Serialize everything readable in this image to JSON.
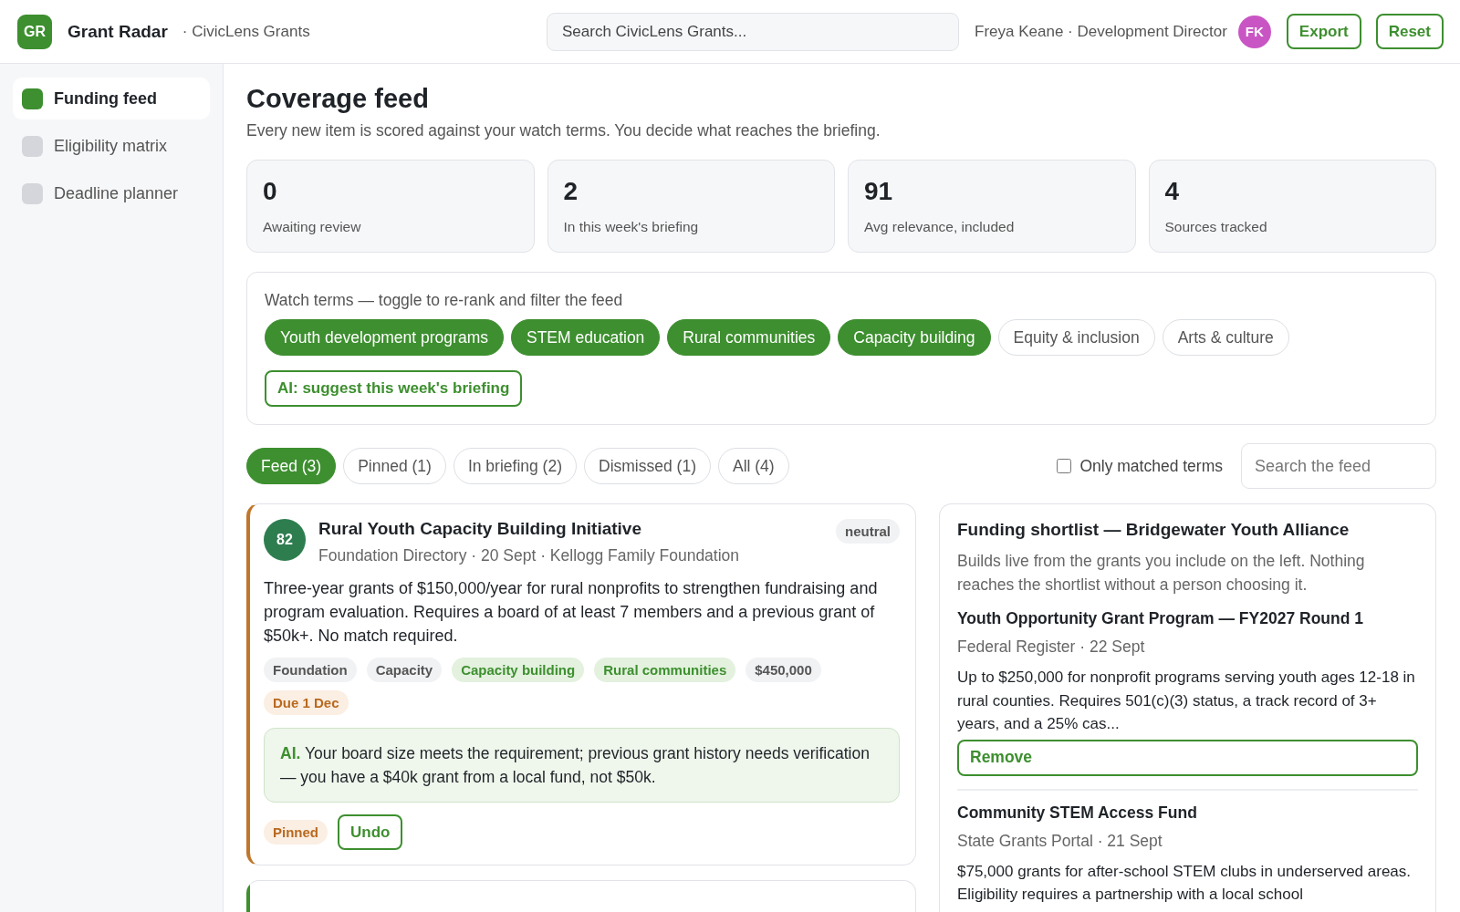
{
  "header": {
    "logo": "GR",
    "app_name": "Grant Radar",
    "workspace": "· CivicLens Grants",
    "search": {
      "placeholder": "Search CivicLens Grants..."
    },
    "user": "Freya Keane · Development Director",
    "avatar": {
      "initials": "FK",
      "color": "#c955c4"
    },
    "buttons": [
      "Export",
      "Reset"
    ]
  },
  "sidebar": {
    "items": [
      {
        "label": "Funding feed",
        "selected": true
      },
      {
        "label": "Eligibility matrix",
        "selected": false
      },
      {
        "label": "Deadline planner",
        "selected": false
      }
    ]
  },
  "page": {
    "title": "Coverage feed",
    "subtitle": "Every new item is scored against your watch terms. You decide what reaches the briefing."
  },
  "stats": [
    {
      "value": "0",
      "label": "Awaiting review"
    },
    {
      "value": "2",
      "label": "In this week's briefing"
    },
    {
      "value": "91",
      "label": "Avg relevance, included"
    },
    {
      "value": "4",
      "label": "Sources tracked"
    }
  ],
  "watch_terms": {
    "title": "Watch terms — toggle to re-rank and filter the feed",
    "terms": [
      {
        "label": "Youth development programs",
        "on": true
      },
      {
        "label": "STEM education",
        "on": true
      },
      {
        "label": "Rural communities",
        "on": true
      },
      {
        "label": "Capacity building",
        "on": true
      },
      {
        "label": "Equity & inclusion",
        "on": false
      },
      {
        "label": "Arts & culture",
        "on": false
      }
    ],
    "ai_button": "AI: suggest this week's briefing"
  },
  "filter_tabs": [
    {
      "label": "Feed (3)",
      "selected": true
    },
    {
      "label": "Pinned (1)",
      "selected": false
    },
    {
      "label": "In briefing (2)",
      "selected": false
    },
    {
      "label": "Dismissed (1)",
      "selected": false
    },
    {
      "label": "All (4)",
      "selected": false
    }
  ],
  "only_matched": {
    "label": "Only matched terms",
    "checked": false
  },
  "feed_search": {
    "placeholder": "Search the feed"
  },
  "feed_items": [
    {
      "color": "#c0762a",
      "score": "82",
      "title": "Rural Youth Capacity Building Initiative",
      "sentiment": "neutral",
      "meta": "Foundation Directory · 20 Sept · Kellogg Family Foundation",
      "description": "Three-year grants of $150,000/year for rural nonprofits to strengthen fundraising and program evaluation. Requires a board of at least 7 members and a previous grant of $50k+. No match required.",
      "tags": [
        {
          "label": "Foundation",
          "matched": false
        },
        {
          "label": "Capacity",
          "matched": false
        },
        {
          "label": "Capacity building",
          "matched": true
        },
        {
          "label": "Rural communities",
          "matched": true
        },
        {
          "label": "$450,000",
          "matched": false
        }
      ],
      "due": "Due 1 Dec",
      "ai_note": "**AI.** Your board size meets the requirement; previous grant history needs verification — you have a $40k grant from a local fund, not $50k.",
      "status": "Pinned",
      "action": "Undo"
    },
    {
      "color": "#3d8f2f"
    }
  ],
  "shortlist": {
    "title": "Funding shortlist — Bridgewater Youth Alliance",
    "note": "Builds live from the grants you include on the left. Nothing reaches the shortlist without a person choosing it.",
    "items": [
      {
        "title": "Youth Opportunity Grant Program — FY2027 Round 1",
        "meta": "Federal Register · 22 Sept",
        "description": "Up to $250,000 for nonprofit programs serving youth ages 12-18 in rural counties. Requires 501(c)(3) status, a track record of 3+ years, and a 25% cas...",
        "action": "Remove"
      },
      {
        "title": "Community STEM Access Fund",
        "meta": "State Grants Portal · 21 Sept",
        "description": "$75,000 grants for after-school STEM clubs in underserved areas. Eligibility requires a partnership with a local school"
      }
    ]
  }
}
